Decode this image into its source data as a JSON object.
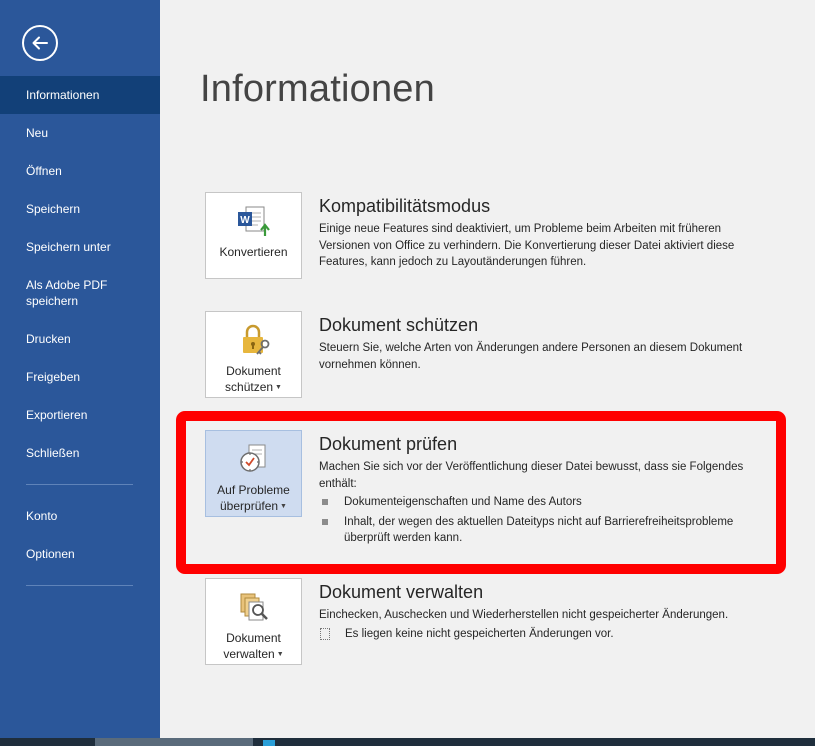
{
  "sidebar": {
    "items": [
      {
        "label": "Informationen",
        "active": true
      },
      {
        "label": "Neu"
      },
      {
        "label": "Öffnen"
      },
      {
        "label": "Speichern"
      },
      {
        "label": "Speichern unter"
      },
      {
        "label": "Als Adobe PDF speichern"
      },
      {
        "label": "Drucken"
      },
      {
        "label": "Freigeben"
      },
      {
        "label": "Exportieren"
      },
      {
        "label": "Schließen"
      },
      {
        "label": "Konto"
      },
      {
        "label": "Optionen"
      }
    ]
  },
  "main": {
    "title": "Informationen",
    "sections": [
      {
        "button_label": "Konvertieren",
        "title": "Kompatibilitätsmodus",
        "description": "Einige neue Features sind deaktiviert, um Probleme beim Arbeiten mit früheren Versionen von Office zu verhindern. Die Konvertierung dieser Datei aktiviert diese Features, kann jedoch zu Layoutänderungen führen."
      },
      {
        "button_label_1": "Dokument",
        "button_label_2": "schützen",
        "title": "Dokument schützen",
        "description": "Steuern Sie, welche Arten von Änderungen andere Personen an diesem Dokument vornehmen können."
      },
      {
        "button_label_1": "Auf Probleme",
        "button_label_2": "überprüfen",
        "title": "Dokument prüfen",
        "description": "Machen Sie sich vor der Veröffentlichung dieser Datei bewusst, dass sie Folgendes enthält:",
        "bullets": [
          "Dokumenteigenschaften und Name des Autors",
          "Inhalt, der wegen des aktuellen Dateityps nicht auf Barrierefreiheitsprobleme überprüft werden kann."
        ]
      },
      {
        "button_label_1": "Dokument",
        "button_label_2": "verwalten",
        "title": "Dokument verwalten",
        "description": "Einchecken, Auschecken und Wiederherstellen nicht gespeicherter Änderungen.",
        "info": "Es liegen keine nicht gespeicherten Änderungen vor."
      }
    ]
  },
  "colors": {
    "sidebar": "#2b579a",
    "sidebar_active": "#124078",
    "highlight": "#ff0000"
  }
}
